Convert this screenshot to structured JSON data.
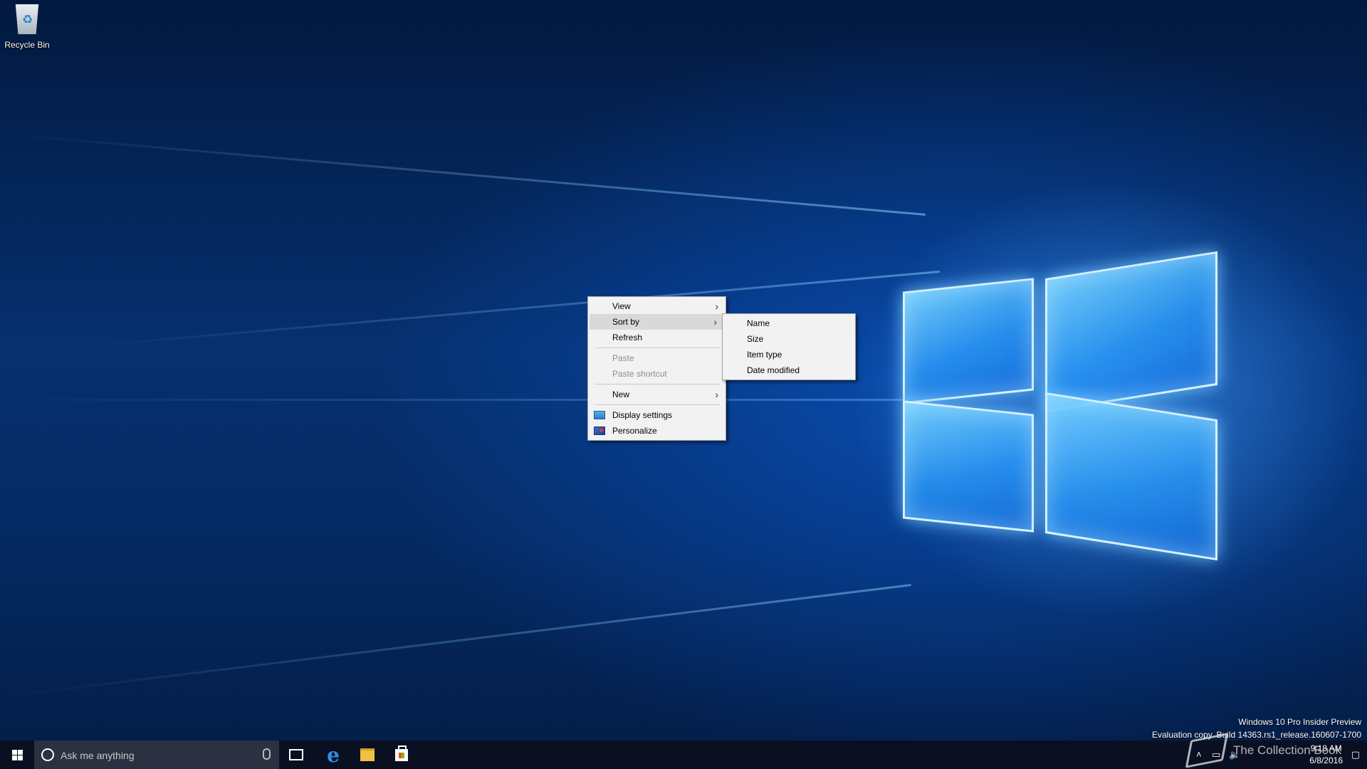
{
  "desktop": {
    "recycle_bin_label": "Recycle Bin"
  },
  "context_menu": {
    "items": [
      {
        "label": "View",
        "submenu": true
      },
      {
        "label": "Sort by",
        "submenu": true,
        "highlighted": true
      },
      {
        "label": "Refresh"
      },
      {
        "label": "Paste",
        "disabled": true
      },
      {
        "label": "Paste shortcut",
        "disabled": true
      },
      {
        "label": "New",
        "submenu": true
      },
      {
        "label": "Display settings",
        "icon": "display-icon"
      },
      {
        "label": "Personalize",
        "icon": "personalize-icon"
      }
    ]
  },
  "sort_submenu": {
    "items": [
      "Name",
      "Size",
      "Item type",
      "Date modified"
    ]
  },
  "watermark": {
    "line1": "Windows 10 Pro Insider Preview",
    "line2": "Evaluation copy. Build 14363.rs1_release.160607-1700"
  },
  "taskbar": {
    "search_placeholder": "Ask me anything",
    "pinned": [
      "task-view-icon",
      "edge-icon",
      "file-explorer-icon",
      "store-icon"
    ],
    "clock_time": "9:18 AM",
    "clock_date": "6/8/2016",
    "overlay_text": "The Collection Book"
  },
  "colors": {
    "taskbar": "#0a1022",
    "menu_background": "#f2f2f2",
    "menu_highlight": "#d9d9d9",
    "accent": "#2f8fe6"
  }
}
